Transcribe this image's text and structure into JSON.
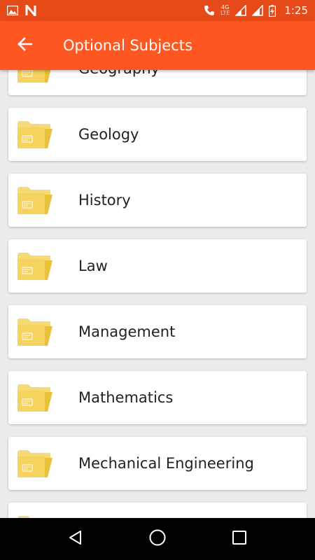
{
  "status_bar": {
    "time": "1:25",
    "network_label": "4G",
    "lte_label": "LTE",
    "icons": [
      "image-icon",
      "n-app-icon",
      "call-icon",
      "signal-icon",
      "signal-icon",
      "battery-charging-icon"
    ]
  },
  "app_bar": {
    "title": "Optional Subjects",
    "back_icon": "arrow-back-icon",
    "color": "#ff5722"
  },
  "subjects": [
    "Geography",
    "Geology",
    "History",
    "Law",
    "Management",
    "Mathematics",
    "Mechanical Engineering",
    ""
  ],
  "folder_color": "#f4d35e",
  "nav_bar": {
    "icons": [
      "back-triangle-icon",
      "home-circle-icon",
      "recents-square-icon"
    ]
  }
}
